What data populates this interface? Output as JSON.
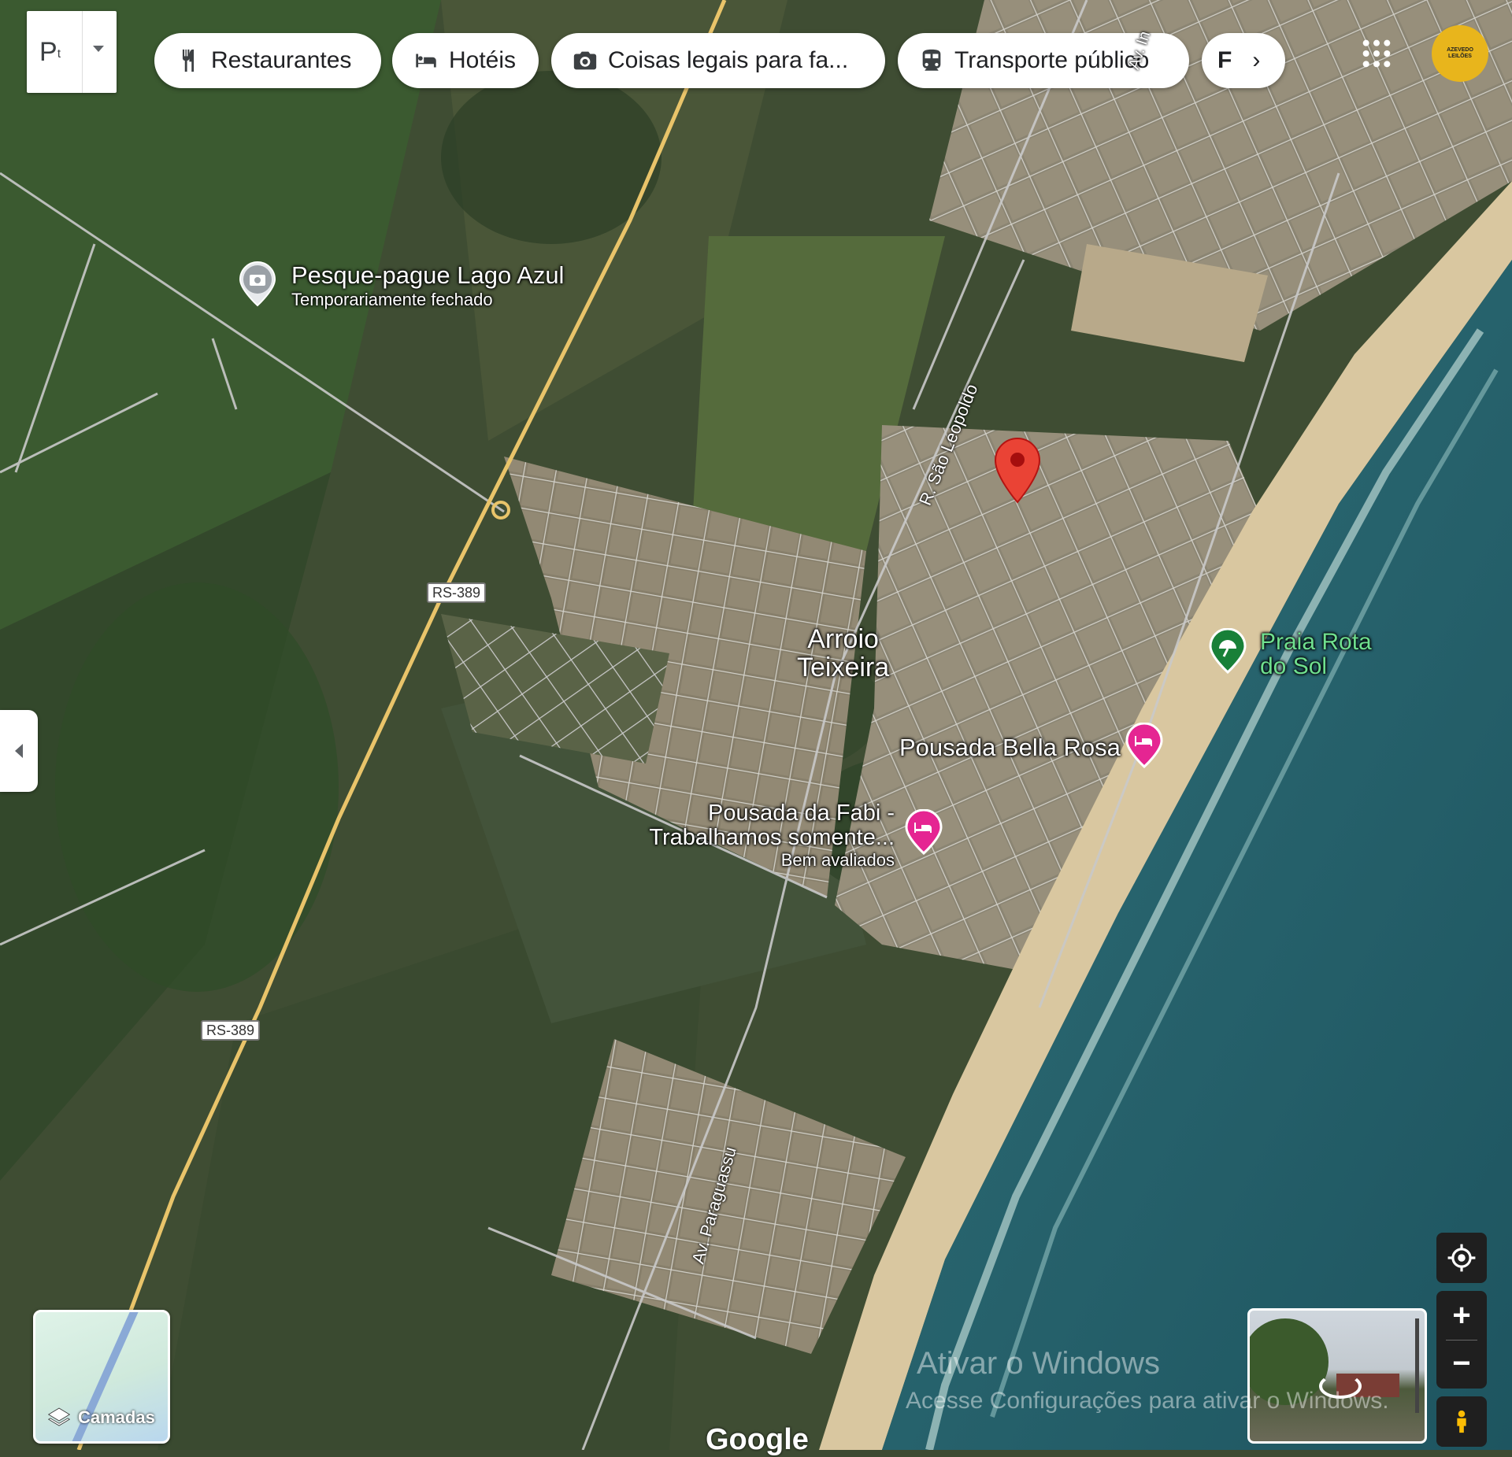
{
  "search": {
    "value": "P"
  },
  "chips": [
    {
      "label": "Restaurantes",
      "icon": "fork-knife-icon"
    },
    {
      "label": "Hotéis",
      "icon": "bed-icon"
    },
    {
      "label": "Coisas legais para fa...",
      "icon": "camera-icon"
    },
    {
      "label": "Transporte público",
      "icon": "train-icon"
    },
    {
      "label": "F",
      "icon": "chevron-right-icon"
    }
  ],
  "places": {
    "lake": {
      "title": "Pesque-pague Lago Azul",
      "subtitle": "Temporariamente fechado"
    },
    "town": {
      "line1": "Arroio",
      "line2": "Teixeira"
    },
    "beach": {
      "line1": "Praia Rota",
      "line2": "do Sol"
    },
    "bella": {
      "title": "Pousada Bella Rosa"
    },
    "fabi": {
      "line1": "Pousada da Fabi -",
      "line2": "Trabalhamos somente...",
      "subtitle": "Bem avaliados"
    }
  },
  "roads": {
    "rs_top": "RS-389",
    "rs_bottom": "RS-389",
    "leopoldo": "R. São Leopoldo",
    "paraguassu": "Av. Paraguassu",
    "top_cut": "Av. In"
  },
  "controls": {
    "layers_label": "Camadas",
    "zoom_in": "+",
    "zoom_out": "−",
    "account_text": "AZEVEDO LEILÕES"
  },
  "watermark": {
    "line1": "Ativar o Windows",
    "line2": "Acesse Configurações para ativar o Windows."
  },
  "logo": "Google",
  "colors": {
    "pin_red": "#ea4335",
    "hotel_pink": "#e52592",
    "beach_green": "#188038",
    "beach_label": "#6fe08f",
    "highway": "#e9c46a",
    "road": "#c9c9c9"
  }
}
